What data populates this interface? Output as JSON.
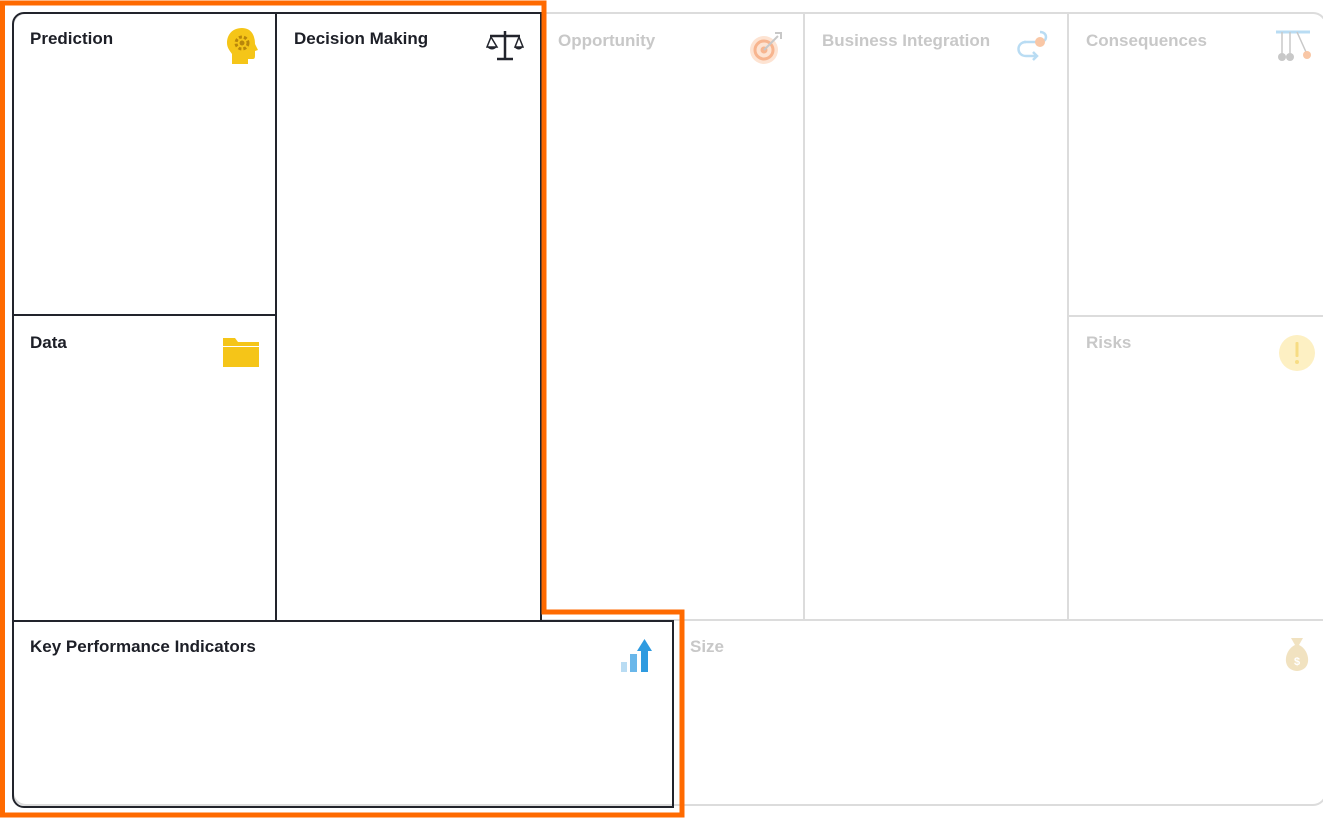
{
  "canvas": {
    "cells": {
      "prediction": {
        "title": "Prediction",
        "icon": "head-gear-icon"
      },
      "decision_making": {
        "title": "Decision Making",
        "icon": "balance-scale-icon"
      },
      "opportunity": {
        "title": "Opportunity",
        "icon": "target-icon"
      },
      "business_integration": {
        "title": "Business Integration",
        "icon": "flow-arrow-icon"
      },
      "consequences": {
        "title": "Consequences",
        "icon": "pendulum-icon"
      },
      "data": {
        "title": "Data",
        "icon": "folder-icon"
      },
      "risks": {
        "title": "Risks",
        "icon": "exclamation-icon"
      },
      "kpi": {
        "title": "Key Performance Indicators",
        "icon": "bar-chart-up-icon"
      },
      "size": {
        "title": "Size",
        "icon": "money-bag-icon"
      }
    }
  },
  "colors": {
    "highlight": "#ff6a00",
    "dark_border": "#22242c",
    "faded_border": "#dcdcdc",
    "faded_text": "#c8c8c8",
    "gold": "#f5c518",
    "blue": "#2f9be0"
  }
}
